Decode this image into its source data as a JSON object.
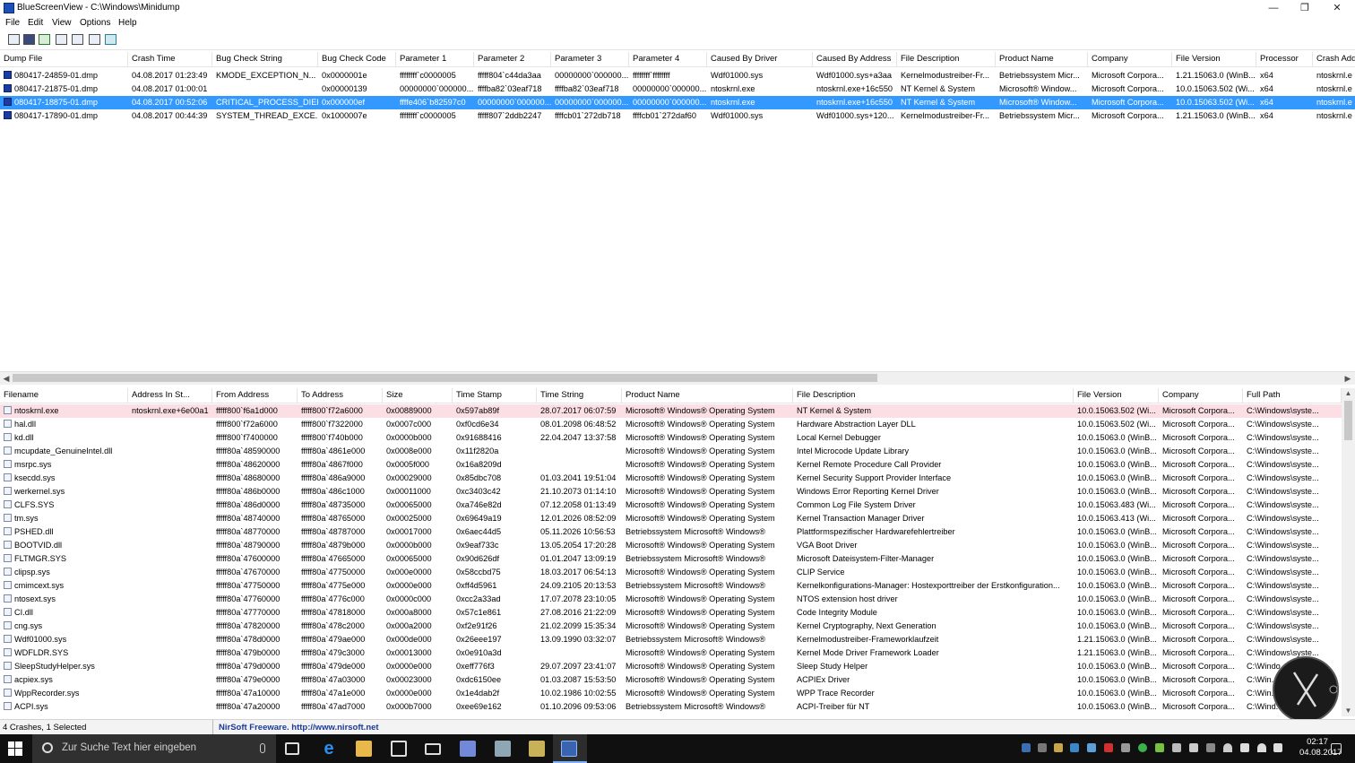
{
  "window": {
    "title": "BlueScreenView  -  C:\\Windows\\Minidump",
    "min": "—",
    "max": "❐",
    "close": "✕"
  },
  "menu": [
    "File",
    "Edit",
    "View",
    "Options",
    "Help"
  ],
  "toolbar_icons": [
    "properties-icon",
    "save-icon",
    "refresh-icon",
    "copy-icon",
    "options-icon",
    "find-icon",
    "exit-icon"
  ],
  "upper": {
    "columns": [
      "Dump File",
      "Crash Time",
      "Bug Check String",
      "Bug Check Code",
      "Parameter 1",
      "Parameter 2",
      "Parameter 3",
      "Parameter 4",
      "Caused By Driver",
      "Caused By Address",
      "File Description",
      "Product Name",
      "Company",
      "File Version",
      "Processor",
      "Crash Add"
    ],
    "sort_arrow": "▽",
    "rows": [
      [
        "080417-24859-01.dmp",
        "04.08.2017 01:23:49",
        "KMODE_EXCEPTION_N...",
        "0x0000001e",
        "ffffffff`c0000005",
        "fffff804`c44da3aa",
        "00000000`000000...",
        "ffffffff`ffffffff",
        "Wdf01000.sys",
        "Wdf01000.sys+a3aa",
        "Kernelmodustreiber-Fr...",
        "Betriebssystem Micr...",
        "Microsoft Corpora...",
        "1.21.15063.0 (WinB...",
        "x64",
        "ntoskrnl.e"
      ],
      [
        "080417-21875-01.dmp",
        "04.08.2017 01:00:01",
        "",
        "0x00000139",
        "00000000`000000...",
        "ffffba82`03eaf718",
        "ffffba82`03eaf718",
        "00000000`000000...",
        "ntoskrnl.exe",
        "ntoskrnl.exe+16c550",
        "NT Kernel & System",
        "Microsoft® Window...",
        "Microsoft Corpora...",
        "10.0.15063.502 (Wi...",
        "x64",
        "ntoskrnl.e"
      ],
      [
        "080417-18875-01.dmp",
        "04.08.2017 00:52:06",
        "CRITICAL_PROCESS_DIED",
        "0x000000ef",
        "ffffe406`b82597c0",
        "00000000`000000...",
        "00000000`000000...",
        "00000000`000000...",
        "ntoskrnl.exe",
        "ntoskrnl.exe+16c550",
        "NT Kernel & System",
        "Microsoft® Window...",
        "Microsoft Corpora...",
        "10.0.15063.502 (Wi...",
        "x64",
        "ntoskrnl.e"
      ],
      [
        "080417-17890-01.dmp",
        "04.08.2017 00:44:39",
        "SYSTEM_THREAD_EXCE...",
        "0x1000007e",
        "ffffffff`c0000005",
        "fffff807`2ddb2247",
        "ffffcb01`272db718",
        "ffffcb01`272daf60",
        "Wdf01000.sys",
        "Wdf01000.sys+120...",
        "Kernelmodustreiber-Fr...",
        "Betriebssystem Micr...",
        "Microsoft Corpora...",
        "1.21.15063.0 (WinB...",
        "x64",
        "ntoskrnl.e"
      ]
    ]
  },
  "lower": {
    "columns": [
      "Filename",
      "Address In St...",
      "From Address",
      "To Address",
      "Size",
      "Time Stamp",
      "Time String",
      "Product Name",
      "File Description",
      "File Version",
      "Company",
      "Full Path"
    ],
    "sort_arrow": "/",
    "rows": [
      [
        "ntoskrnl.exe",
        "ntoskrnl.exe+6e00a1",
        "fffff800`f6a1d000",
        "fffff800`f72a6000",
        "0x00889000",
        "0x597ab89f",
        "28.07.2017 06:07:59",
        "Microsoft® Windows® Operating System",
        "NT Kernel & System",
        "10.0.15063.502 (Wi...",
        "Microsoft Corpora...",
        "C:\\Windows\\syste..."
      ],
      [
        "hal.dll",
        "",
        "fffff800`f72a6000",
        "fffff800`f7322000",
        "0x0007c000",
        "0xf0cd6e34",
        "08.01.2098 06:48:52",
        "Microsoft® Windows® Operating System",
        "Hardware Abstraction Layer DLL",
        "10.0.15063.502 (Wi...",
        "Microsoft Corpora...",
        "C:\\Windows\\syste..."
      ],
      [
        "kd.dll",
        "",
        "fffff800`f7400000",
        "fffff800`f740b000",
        "0x0000b000",
        "0x91688416",
        "22.04.2047 13:37:58",
        "Microsoft® Windows® Operating System",
        "Local Kernel Debugger",
        "10.0.15063.0 (WinB...",
        "Microsoft Corpora...",
        "C:\\Windows\\syste..."
      ],
      [
        "mcupdate_GenuineIntel.dll",
        "",
        "fffff80a`48590000",
        "fffff80a`4861e000",
        "0x0008e000",
        "0x11f2820a",
        "",
        "Microsoft® Windows® Operating System",
        "Intel Microcode Update Library",
        "10.0.15063.0 (WinB...",
        "Microsoft Corpora...",
        "C:\\Windows\\syste..."
      ],
      [
        "msrpc.sys",
        "",
        "fffff80a`48620000",
        "fffff80a`4867f000",
        "0x0005f000",
        "0x16a8209d",
        "",
        "Microsoft® Windows® Operating System",
        "Kernel Remote Procedure Call Provider",
        "10.0.15063.0 (WinB...",
        "Microsoft Corpora...",
        "C:\\Windows\\syste..."
      ],
      [
        "ksecdd.sys",
        "",
        "fffff80a`48680000",
        "fffff80a`486a9000",
        "0x00029000",
        "0x85dbc708",
        "01.03.2041 19:51:04",
        "Microsoft® Windows® Operating System",
        "Kernel Security Support Provider Interface",
        "10.0.15063.0 (WinB...",
        "Microsoft Corpora...",
        "C:\\Windows\\syste..."
      ],
      [
        "werkernel.sys",
        "",
        "fffff80a`486b0000",
        "fffff80a`486c1000",
        "0x00011000",
        "0xc3403c42",
        "21.10.2073 01:14:10",
        "Microsoft® Windows® Operating System",
        "Windows Error Reporting Kernel Driver",
        "10.0.15063.0 (WinB...",
        "Microsoft Corpora...",
        "C:\\Windows\\syste..."
      ],
      [
        "CLFS.SYS",
        "",
        "fffff80a`486d0000",
        "fffff80a`48735000",
        "0x00065000",
        "0xa746e82d",
        "07.12.2058 01:13:49",
        "Microsoft® Windows® Operating System",
        "Common Log File System Driver",
        "10.0.15063.483 (Wi...",
        "Microsoft Corpora...",
        "C:\\Windows\\syste..."
      ],
      [
        "tm.sys",
        "",
        "fffff80a`48740000",
        "fffff80a`48765000",
        "0x00025000",
        "0x69649a19",
        "12.01.2026 08:52:09",
        "Microsoft® Windows® Operating System",
        "Kernel Transaction Manager Driver",
        "10.0.15063.413 (Wi...",
        "Microsoft Corpora...",
        "C:\\Windows\\syste..."
      ],
      [
        "PSHED.dll",
        "",
        "fffff80a`48770000",
        "fffff80a`48787000",
        "0x00017000",
        "0x6aec44d5",
        "05.11.2026 10:56:53",
        "Betriebssystem Microsoft® Windows®",
        "Plattformspezifischer Hardwarefehlertreiber",
        "10.0.15063.0 (WinB...",
        "Microsoft Corpora...",
        "C:\\Windows\\syste..."
      ],
      [
        "BOOTVID.dll",
        "",
        "fffff80a`48790000",
        "fffff80a`4879b000",
        "0x0000b000",
        "0x9eaf733c",
        "13.05.2054 17:20:28",
        "Microsoft® Windows® Operating System",
        "VGA Boot Driver",
        "10.0.15063.0 (WinB...",
        "Microsoft Corpora...",
        "C:\\Windows\\syste..."
      ],
      [
        "FLTMGR.SYS",
        "",
        "fffff80a`47600000",
        "fffff80a`47665000",
        "0x00065000",
        "0x90d626df",
        "01.01.2047 13:09:19",
        "Betriebssystem Microsoft® Windows®",
        "Microsoft Dateisystem-Filter-Manager",
        "10.0.15063.0 (WinB...",
        "Microsoft Corpora...",
        "C:\\Windows\\syste..."
      ],
      [
        "clipsp.sys",
        "",
        "fffff80a`47670000",
        "fffff80a`47750000",
        "0x000e0000",
        "0x58ccbd75",
        "18.03.2017 06:54:13",
        "Microsoft® Windows® Operating System",
        "CLIP Service",
        "10.0.15063.0 (WinB...",
        "Microsoft Corpora...",
        "C:\\Windows\\syste..."
      ],
      [
        "cmimcext.sys",
        "",
        "fffff80a`47750000",
        "fffff80a`4775e000",
        "0x0000e000",
        "0xff4d5961",
        "24.09.2105 20:13:53",
        "Betriebssystem Microsoft® Windows®",
        "Kernelkonfigurations-Manager: Hostexporttreiber der Erstkonfiguration...",
        "10.0.15063.0 (WinB...",
        "Microsoft Corpora...",
        "C:\\Windows\\syste..."
      ],
      [
        "ntosext.sys",
        "",
        "fffff80a`47760000",
        "fffff80a`4776c000",
        "0x0000c000",
        "0xcc2a33ad",
        "17.07.2078 23:10:05",
        "Microsoft® Windows® Operating System",
        "NTOS extension host driver",
        "10.0.15063.0 (WinB...",
        "Microsoft Corpora...",
        "C:\\Windows\\syste..."
      ],
      [
        "CI.dll",
        "",
        "fffff80a`47770000",
        "fffff80a`47818000",
        "0x000a8000",
        "0x57c1e861",
        "27.08.2016 21:22:09",
        "Microsoft® Windows® Operating System",
        "Code Integrity Module",
        "10.0.15063.0 (WinB...",
        "Microsoft Corpora...",
        "C:\\Windows\\syste..."
      ],
      [
        "cng.sys",
        "",
        "fffff80a`47820000",
        "fffff80a`478c2000",
        "0x000a2000",
        "0xf2e91f26",
        "21.02.2099 15:35:34",
        "Microsoft® Windows® Operating System",
        "Kernel Cryptography, Next Generation",
        "10.0.15063.0 (WinB...",
        "Microsoft Corpora...",
        "C:\\Windows\\syste..."
      ],
      [
        "Wdf01000.sys",
        "",
        "fffff80a`478d0000",
        "fffff80a`479ae000",
        "0x000de000",
        "0x26eee197",
        "13.09.1990 03:32:07",
        "Betriebssystem Microsoft® Windows®",
        "Kernelmodustreiber-Frameworklaufzeit",
        "1.21.15063.0 (WinB...",
        "Microsoft Corpora...",
        "C:\\Windows\\syste..."
      ],
      [
        "WDFLDR.SYS",
        "",
        "fffff80a`479b0000",
        "fffff80a`479c3000",
        "0x00013000",
        "0x0e910a3d",
        "",
        "Microsoft® Windows® Operating System",
        "Kernel Mode Driver Framework Loader",
        "1.21.15063.0 (WinB...",
        "Microsoft Corpora...",
        "C:\\Windows\\syste..."
      ],
      [
        "SleepStudyHelper.sys",
        "",
        "fffff80a`479d0000",
        "fffff80a`479de000",
        "0x0000e000",
        "0xeff776f3",
        "29.07.2097 23:41:07",
        "Microsoft® Windows® Operating System",
        "Sleep Study Helper",
        "10.0.15063.0 (WinB...",
        "Microsoft Corpora...",
        "C:\\Windo..."
      ],
      [
        "acpiex.sys",
        "",
        "fffff80a`479e0000",
        "fffff80a`47a03000",
        "0x00023000",
        "0xdc6150ee",
        "01.03.2087 15:53:50",
        "Microsoft® Windows® Operating System",
        "ACPIEx Driver",
        "10.0.15063.0 (WinB...",
        "Microsoft Corpora...",
        "C:\\Win..."
      ],
      [
        "WppRecorder.sys",
        "",
        "fffff80a`47a10000",
        "fffff80a`47a1e000",
        "0x0000e000",
        "0x1e4dab2f",
        "10.02.1986 10:02:55",
        "Microsoft® Windows® Operating System",
        "WPP Trace Recorder",
        "10.0.15063.0 (WinB...",
        "Microsoft Corpora...",
        "C:\\Win..."
      ],
      [
        "ACPI.sys",
        "",
        "fffff80a`47a20000",
        "fffff80a`47ad7000",
        "0x000b7000",
        "0xee69e162",
        "01.10.2096 09:53:06",
        "Betriebssystem Microsoft® Windows®",
        "ACPI-Treiber für NT",
        "10.0.15063.0 (WinB...",
        "Microsoft Corpora...",
        "C:\\Wind..."
      ]
    ]
  },
  "status": {
    "count": "4 Crashes, 1 Selected",
    "freeware": "NirSoft Freeware.  http://www.nirsoft.net"
  },
  "taskbar": {
    "search_placeholder": "Zur Suche Text hier eingeben",
    "time": "02:17",
    "date": "04.08.2017"
  }
}
